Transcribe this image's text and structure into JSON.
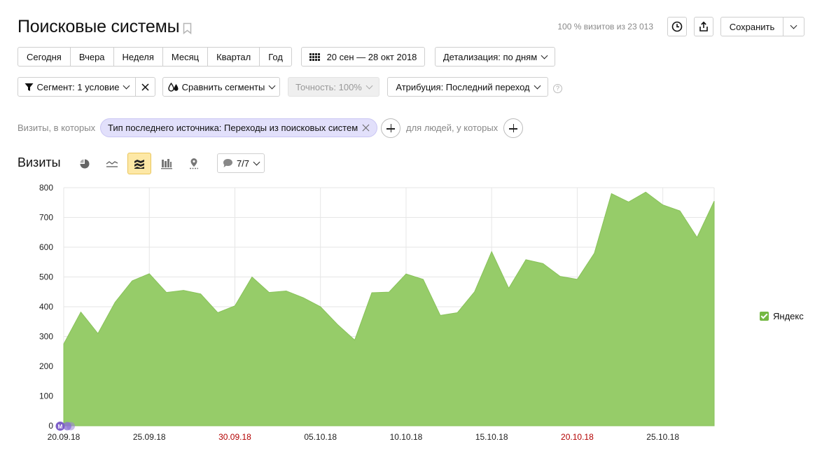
{
  "page": {
    "title": "Поисковые системы",
    "visits_note": "100 % визитов из 23 013",
    "save_label": "Сохранить"
  },
  "period": {
    "items": [
      "Сегодня",
      "Вчера",
      "Неделя",
      "Месяц",
      "Квартал",
      "Год"
    ],
    "date_range": "20 сен — 28 окт 2018",
    "detail_label": "Детализация: по дням"
  },
  "filters": {
    "segment_label": "Сегмент: 1 условие",
    "compare_label": "Сравнить сегменты",
    "accuracy_label": "Точность: 100%",
    "attribution_label": "Атрибуция: Последний переход",
    "help_glyph": "?",
    "visits_where_label": "Визиты, в которых",
    "condition_chip": "Тип последнего источника: Переходы из поисковых систем",
    "people_where_label": "для людей, у которых"
  },
  "chart_section": {
    "title": "Визиты",
    "annotations_label": "7/7",
    "marker_label": "M"
  },
  "colors": {
    "area_fill": "#96cc69",
    "area_stroke": "#88c25a",
    "weekend_tick": "#b30000",
    "legend_check": "#74b843",
    "marker": "#7e5fc9"
  },
  "chart_data": {
    "type": "area",
    "ylim": [
      0,
      800
    ],
    "yticks": [
      "0",
      "100",
      "200",
      "300",
      "400",
      "500",
      "600",
      "700",
      "800"
    ],
    "xtick_labels": [
      {
        "label": "20.09.18",
        "index": 0,
        "weekend": false
      },
      {
        "label": "25.09.18",
        "index": 5,
        "weekend": false
      },
      {
        "label": "30.09.18",
        "index": 10,
        "weekend": true
      },
      {
        "label": "05.10.18",
        "index": 15,
        "weekend": false
      },
      {
        "label": "10.10.18",
        "index": 20,
        "weekend": false
      },
      {
        "label": "15.10.18",
        "index": 25,
        "weekend": false
      },
      {
        "label": "20.10.18",
        "index": 30,
        "weekend": true
      },
      {
        "label": "25.10.18",
        "index": 35,
        "weekend": false
      }
    ],
    "x": [
      "20.09.18",
      "21.09.18",
      "22.09.18",
      "23.09.18",
      "24.09.18",
      "25.09.18",
      "26.09.18",
      "27.09.18",
      "28.09.18",
      "29.09.18",
      "30.09.18",
      "01.10.18",
      "02.10.18",
      "03.10.18",
      "04.10.18",
      "05.10.18",
      "06.10.18",
      "07.10.18",
      "08.10.18",
      "09.10.18",
      "10.10.18",
      "11.10.18",
      "12.10.18",
      "13.10.18",
      "14.10.18",
      "15.10.18",
      "16.10.18",
      "17.10.18",
      "18.10.18",
      "19.10.18",
      "20.10.18",
      "21.10.18",
      "22.10.18",
      "23.10.18",
      "24.10.18",
      "25.10.18",
      "26.10.18",
      "27.10.18",
      "28.10.18"
    ],
    "series": [
      {
        "name": "Яндекс",
        "values": [
          275,
          382,
          310,
          415,
          487,
          511,
          448,
          455,
          443,
          380,
          403,
          500,
          448,
          453,
          430,
          400,
          340,
          288,
          447,
          449,
          510,
          492,
          371,
          380,
          450,
          585,
          462,
          558,
          545,
          502,
          492,
          580,
          780,
          752,
          785,
          742,
          722,
          633,
          755
        ]
      }
    ],
    "grid": true
  }
}
